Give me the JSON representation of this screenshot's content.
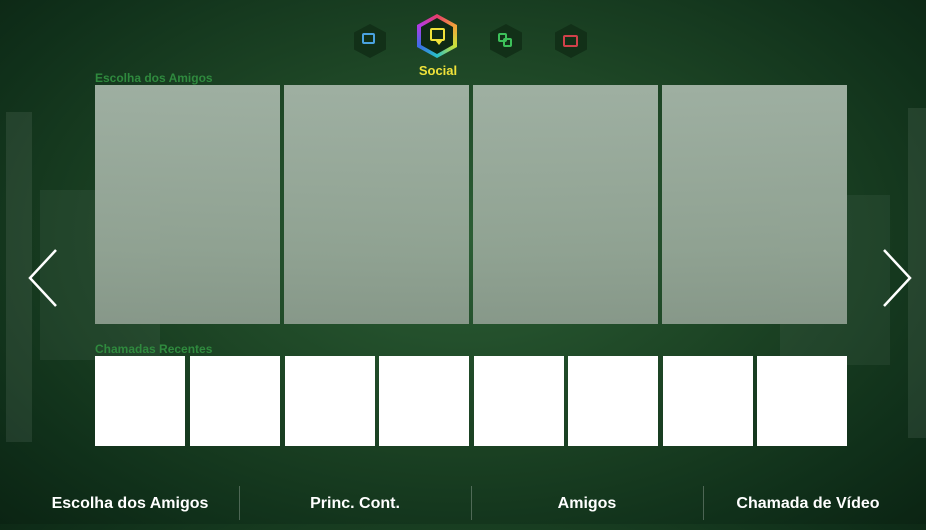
{
  "colors": {
    "accent": "#f0e23a",
    "section_label": "#2f8a3e",
    "background": "#1d4525"
  },
  "top_nav": {
    "icons": [
      {
        "name": "text-icon",
        "color": "#4aa3e0"
      },
      {
        "name": "social-icon",
        "color": "#f0e23a",
        "active": true
      },
      {
        "name": "apps-icon",
        "color": "#3dc15a"
      },
      {
        "name": "camera-icon",
        "color": "#d0414a"
      }
    ],
    "active_label": "Social"
  },
  "sections": {
    "friends_pick": {
      "title": "Escolha dos Amigos",
      "tile_count": 4
    },
    "recent_calls": {
      "title": "Chamadas Recentes",
      "tile_count": 8
    }
  },
  "navigation": {
    "prev": "chevron-left-icon",
    "next": "chevron-right-icon"
  },
  "bottom_tabs": [
    {
      "label": "Escolha dos Amigos"
    },
    {
      "label": "Princ. Cont."
    },
    {
      "label": "Amigos"
    },
    {
      "label": "Chamada de Vídeo"
    }
  ]
}
